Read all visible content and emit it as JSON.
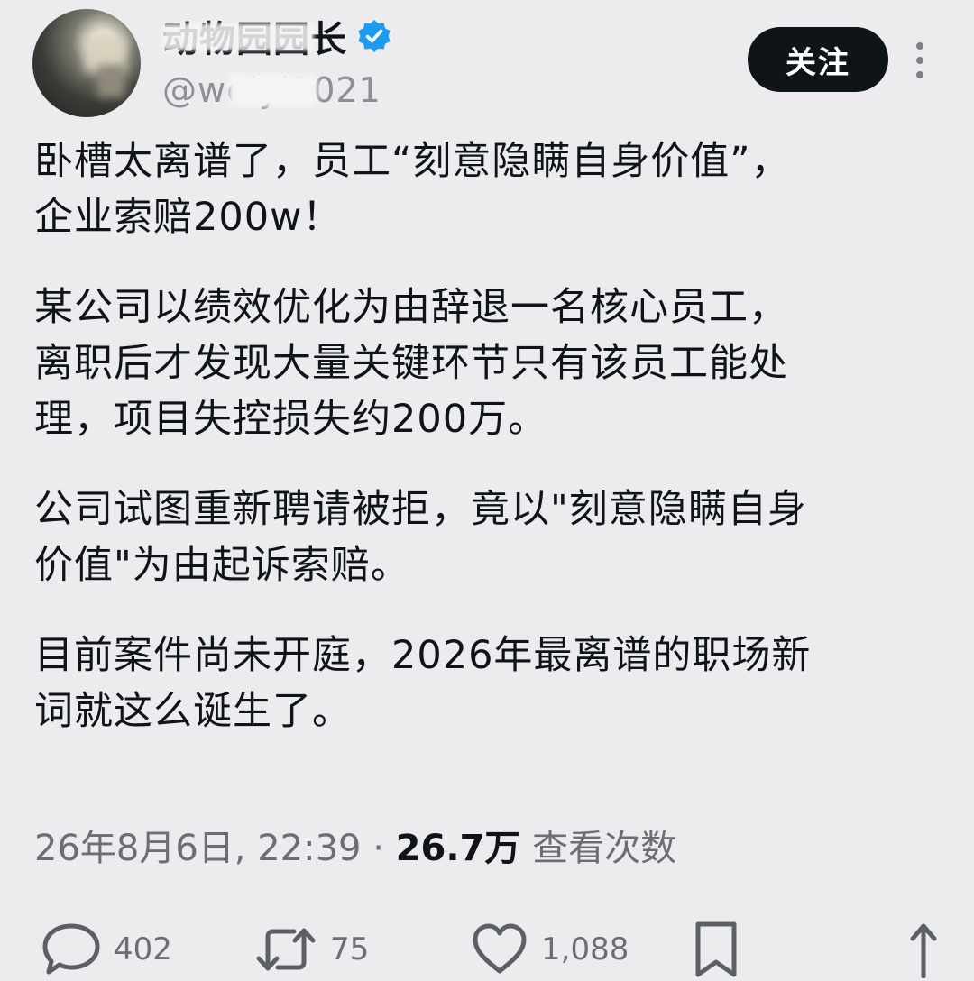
{
  "author": {
    "display_name": "动物园园长",
    "handle": "@weiyi2021",
    "verified_icon": "verified-badge-icon",
    "avatar": "user-avatar"
  },
  "follow_button": {
    "label": "关注"
  },
  "more_icon": "more-vertical-icon",
  "tweet": {
    "paragraphs": [
      "卧槽太离谱了，员工“刻意隐瞒自身价值”，\n企业索赔200w！",
      "某公司以绩效优化为由辞退一名核心员工，\n离职后才发现大量关键环节只有该员工能处\n理，项目失控损失约200万。",
      "公司试图重新聘请被拒，竟以\"刻意隐瞒自身\n价值\"为由起诉索赔。",
      "目前案件尚未开庭，2026年最离谱的职场新\n词就这么诞生了。"
    ]
  },
  "meta": {
    "timestamp": "26年8月6日, 22:39",
    "separator": "·",
    "views_count": "26.7万",
    "views_label": "查看次数"
  },
  "actions": {
    "reply": {
      "icon": "comment-icon",
      "count": "402"
    },
    "retweet": {
      "icon": "retweet-icon",
      "count": "75"
    },
    "like": {
      "icon": "heart-icon",
      "count": "1,088"
    },
    "bookmark": {
      "icon": "bookmark-icon"
    },
    "share": {
      "icon": "share-icon"
    }
  },
  "colors": {
    "background": "#ececee",
    "text": "#0f1419",
    "secondary": "#6b6f75",
    "verified": "#1d9bf0",
    "button": "#0f1419"
  }
}
